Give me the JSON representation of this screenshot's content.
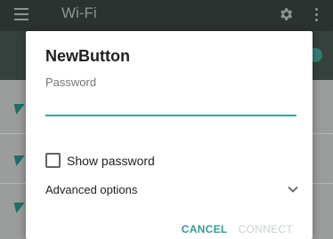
{
  "app_bar": {
    "title": "Wi-Fi"
  },
  "dialog": {
    "title": "NewButton",
    "password_label": "Password",
    "password_value": "",
    "show_password_label": "Show password",
    "show_password_checked": false,
    "advanced_options_label": "Advanced options",
    "cancel_label": "CANCEL",
    "connect_label": "CONNECT"
  },
  "icons": {
    "menu": "hamburger-menu-icon",
    "settings": "gear-icon",
    "overflow": "more-vert-icon",
    "wifi": "wifi-signal-icon",
    "expand": "chevron-down-icon"
  },
  "colors": {
    "accent": "#2f9e93",
    "app_bar": "#2b3230",
    "disabled_text": "#c9d2d0"
  }
}
